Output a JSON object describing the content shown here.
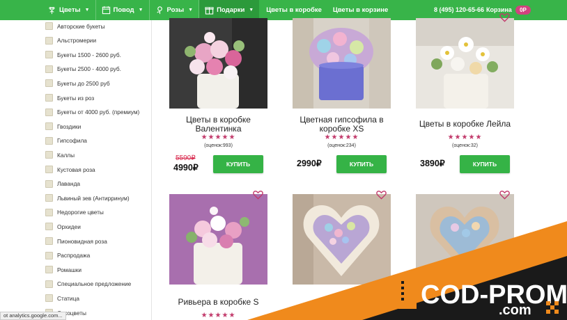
{
  "nav": {
    "items": [
      {
        "label": "Цветы",
        "icon": "flower-icon",
        "has_menu": true
      },
      {
        "label": "Повод",
        "icon": "calendar-icon",
        "has_menu": true
      },
      {
        "label": "Розы",
        "icon": "rose-icon",
        "has_menu": true
      },
      {
        "label": "Подарки",
        "icon": "gift-icon",
        "has_menu": true
      },
      {
        "label": "Цветы в коробке",
        "has_menu": false
      },
      {
        "label": "Цветы в корзине",
        "has_menu": false
      }
    ],
    "phone": "8 (495) 120-65-66",
    "cart_label": "Корзина",
    "cart_count": "0Р"
  },
  "sidebar": {
    "filters": [
      "Авторские букеты",
      "Альстромерии",
      "Букеты 1500 - 2600 руб.",
      "Букеты 2500 - 4000 руб.",
      "Букеты до 2500 руб",
      "Букеты из роз",
      "Букеты от 4000 руб. (премиум)",
      "Гвоздики",
      "Гипсофила",
      "Каллы",
      "Кустовая роза",
      "Лаванда",
      "Львиный зев (Антирринум)",
      "Недорогие цветы",
      "Орхидеи",
      "Пионовидная роза",
      "Распродажа",
      "Ромашки",
      "Специальное предложение",
      "Статица",
      "Сухоцветы"
    ]
  },
  "products": [
    {
      "name": "Цветы в коробке Валентинка",
      "stars": "★★★★★",
      "rating": "(оценок:993)",
      "old_price": "5590₽",
      "price": "4990₽",
      "buy": "КУПИТЬ"
    },
    {
      "name": "Цветная гипсофила в коробке XS",
      "stars": "★★★★★",
      "rating": "(оценок:234)",
      "price": "2990₽",
      "buy": "КУПИТЬ"
    },
    {
      "name": "Цветы в коробке Лейла",
      "stars": "★★★★★",
      "rating": "(оценок:32)",
      "price": "3890₽",
      "buy": "КУПИТЬ"
    },
    {
      "name": "Ривьера в коробке S",
      "stars": "★★★★★"
    },
    {
      "name": ""
    },
    {
      "name": ""
    }
  ],
  "status_url": "ot analytics.google.com...",
  "promo": {
    "line1": "COD-PROMO",
    "line2": ".com"
  },
  "colors": {
    "brand_green": "#38b449",
    "buy_green": "#35b346",
    "accent_pink": "#c23a6b",
    "promo_orange": "#f08a1c"
  }
}
